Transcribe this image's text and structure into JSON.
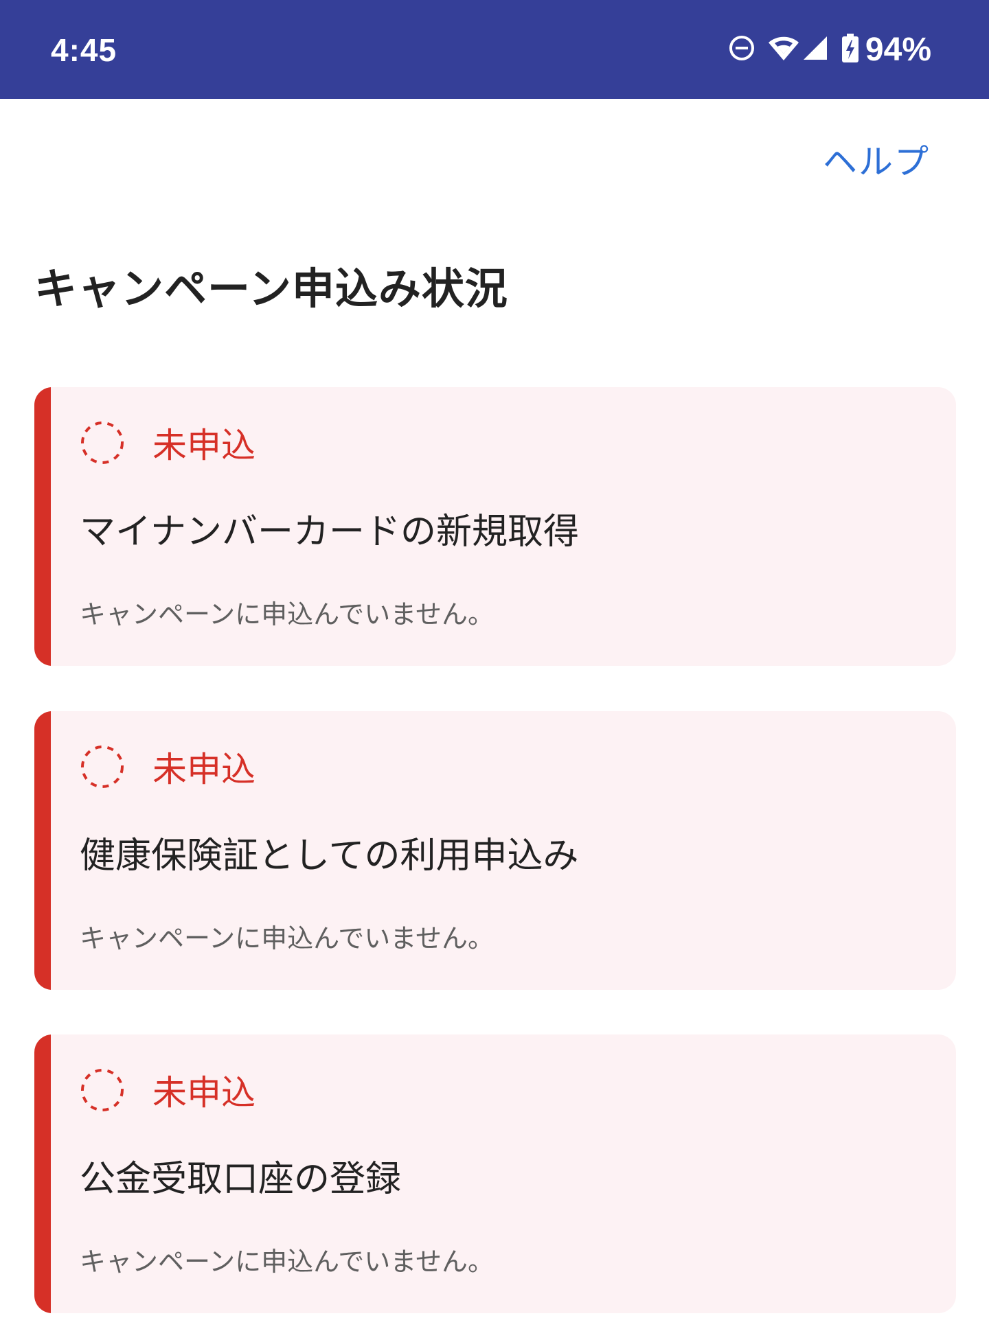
{
  "status_bar": {
    "time": "4:45",
    "battery_percent": "94%",
    "icons": [
      "do-not-disturb-icon",
      "wifi-icon",
      "cell-signal-icon",
      "battery-charging-icon"
    ]
  },
  "header": {
    "help_label": "ヘルプ"
  },
  "page": {
    "title": "キャンペーン申込み状況"
  },
  "colors": {
    "status_bar_bg": "#353f98",
    "accent_red": "#d63027",
    "card_bg": "#fdf2f4",
    "link_blue": "#2d6fd6"
  },
  "campaigns": [
    {
      "status": "未申込",
      "title": "マイナンバーカードの新規取得",
      "description": "キャンペーンに申込んでいません。"
    },
    {
      "status": "未申込",
      "title": "健康保険証としての利用申込み",
      "description": "キャンペーンに申込んでいません。"
    },
    {
      "status": "未申込",
      "title": "公金受取口座の登録",
      "description": "キャンペーンに申込んでいません。"
    }
  ]
}
